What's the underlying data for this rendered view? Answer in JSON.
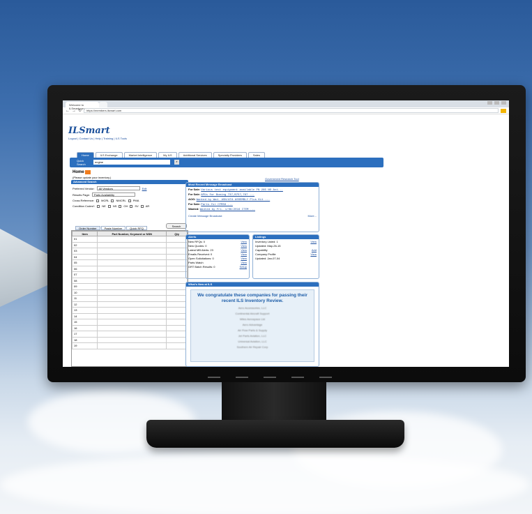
{
  "browser": {
    "tab_title": "Welcome to ILSmart.com",
    "url": "https://members.ilsmart.com"
  },
  "site": {
    "logo": "ILSmart",
    "top_links": "Logout | Contact Us | Help | Training | ILS Tools",
    "tabs": [
      "Home",
      "ILS Exchange",
      "Market Intelligence",
      "My ILS",
      "Additional Services",
      "Specialty Providers",
      "Sales"
    ],
    "quick_search_label": "Quick Search",
    "quick_search_value": "engine"
  },
  "home": {
    "title": "Home",
    "update_note": "(Please update your inventory.)",
    "gov_link": "Government Research Tool"
  },
  "advanced_search": {
    "heading": "Advanced Search",
    "preferred_vendor_label": "Preferred Vendor:",
    "preferred_vendor_value": "All Vendors",
    "edit": "Edit",
    "results_page_label": "Results Page:",
    "results_page_value": "Parts Availability",
    "cross_ref_label": "Cross Reference:",
    "cross_ref_options": [
      "MCRL",
      "NMCRL",
      "PMA"
    ],
    "condition_label": "Condition Codes*:",
    "condition_options": [
      "NE",
      "NS",
      "OH",
      "SV",
      "AR"
    ],
    "search_button": "Search"
  },
  "grid": {
    "tabs": [
      "Order Number",
      "Paste Number",
      "Quick RFQ"
    ],
    "columns": [
      "Item",
      "Part Number, Keyword or NSN",
      "Qty"
    ],
    "rows": [
      "01",
      "02",
      "03",
      "04",
      "05",
      "06",
      "07",
      "08",
      "09",
      "10",
      "11",
      "12",
      "13",
      "14",
      "15",
      "16",
      "17",
      "18",
      "19"
    ]
  },
  "broadcast": {
    "heading": "Most Recent Message Broadcast",
    "items": [
      {
        "label": "For Sale:",
        "text": "Various test equipment available PN 285 NO Avi..."
      },
      {
        "label": "For Sale:",
        "text": "APUs for Boeing 737,B757,767 ..."
      },
      {
        "label": "AOG:",
        "text": "Wanted by Wed. ASN/ATA ASSEMBLY Plus Kit ..."
      },
      {
        "label": "For Sale:",
        "text": "Parts for CFM56 ..."
      },
      {
        "label": "Wanted:",
        "text": "Wanted by Fri. 1/06/2016 ITEM ..."
      }
    ],
    "create_link": "Create Message Broadcast",
    "more_link": "More..."
  },
  "alerts": {
    "heading": "Alerts",
    "items": [
      {
        "label": "New RFQs: 0",
        "action": "View"
      },
      {
        "label": "New Quotes: 0",
        "action": "View"
      },
      {
        "label": "Latest MB Alerts: 23",
        "action": "View"
      },
      {
        "label": "Emails Received: 0",
        "action": "View"
      },
      {
        "label": "Open Solicitations: 0",
        "action": "View"
      },
      {
        "label": "Parts Watch",
        "action": "View"
      },
      {
        "label": "GRT Batch Results: 0",
        "action": "Setup"
      }
    ]
  },
  "listings": {
    "heading": "Listings",
    "items": [
      {
        "label": "Inventory Listed: 1",
        "action": "View"
      },
      {
        "label": "Updated: May-26-15",
        "action": ""
      },
      {
        "label": "Capability",
        "action": "Add"
      },
      {
        "label": "Company Profile",
        "action": "View"
      },
      {
        "label": "Updated: Jan-07-04",
        "action": ""
      }
    ]
  },
  "whats_new": {
    "heading": "What's New at ILS",
    "headline": "We congratulate these companies for passing their recent ILS Inventory Review.",
    "companies": [
      "Aero Accessories, LLC",
      "Continental Aircraft Support",
      "Miles Aerospace Ltd",
      "Aero Advantage",
      "Air Flow Parts & Supply",
      "Jet Parts Aviation, LLC",
      "Universal Aviation, LLC",
      "Southern Air Repair Corp"
    ]
  },
  "colors": {
    "accent": "#2c6fbe",
    "link": "#1c4fa0",
    "badge": "#f07c1d"
  }
}
